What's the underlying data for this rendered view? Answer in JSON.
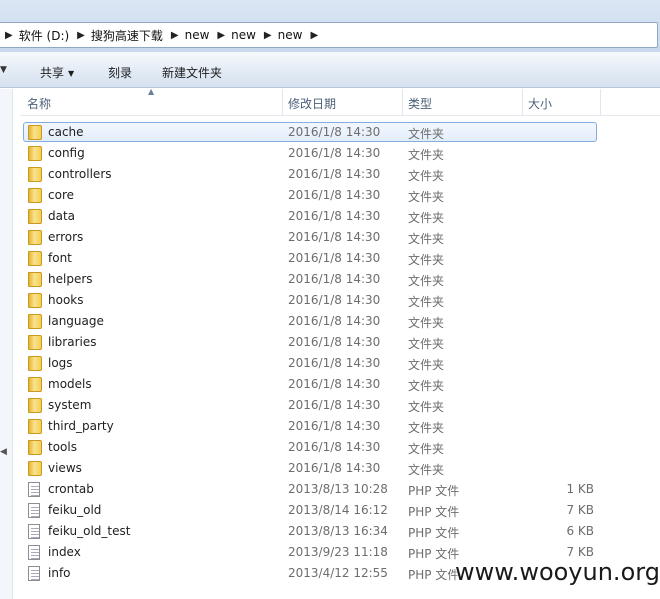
{
  "address_bar": {
    "crumbs": [
      "软件 (D:)",
      "搜狗高速下载",
      "new",
      "new",
      "new"
    ]
  },
  "toolbar": {
    "share_label": "共享",
    "burn_label": "刻录",
    "new_folder_label": "新建文件夹"
  },
  "columns": {
    "name": "名称",
    "modified": "修改日期",
    "type": "类型",
    "size": "大小"
  },
  "files": [
    {
      "name": "cache",
      "date": "2016/1/8 14:30",
      "type": "文件夹",
      "size": "",
      "icon": "folder-icon"
    },
    {
      "name": "config",
      "date": "2016/1/8 14:30",
      "type": "文件夹",
      "size": "",
      "icon": "folder-icon"
    },
    {
      "name": "controllers",
      "date": "2016/1/8 14:30",
      "type": "文件夹",
      "size": "",
      "icon": "folder-icon"
    },
    {
      "name": "core",
      "date": "2016/1/8 14:30",
      "type": "文件夹",
      "size": "",
      "icon": "folder-icon"
    },
    {
      "name": "data",
      "date": "2016/1/8 14:30",
      "type": "文件夹",
      "size": "",
      "icon": "folder-icon"
    },
    {
      "name": "errors",
      "date": "2016/1/8 14:30",
      "type": "文件夹",
      "size": "",
      "icon": "folder-icon"
    },
    {
      "name": "font",
      "date": "2016/1/8 14:30",
      "type": "文件夹",
      "size": "",
      "icon": "folder-icon"
    },
    {
      "name": "helpers",
      "date": "2016/1/8 14:30",
      "type": "文件夹",
      "size": "",
      "icon": "folder-icon"
    },
    {
      "name": "hooks",
      "date": "2016/1/8 14:30",
      "type": "文件夹",
      "size": "",
      "icon": "folder-icon"
    },
    {
      "name": "language",
      "date": "2016/1/8 14:30",
      "type": "文件夹",
      "size": "",
      "icon": "folder-icon"
    },
    {
      "name": "libraries",
      "date": "2016/1/8 14:30",
      "type": "文件夹",
      "size": "",
      "icon": "folder-icon"
    },
    {
      "name": "logs",
      "date": "2016/1/8 14:30",
      "type": "文件夹",
      "size": "",
      "icon": "folder-icon"
    },
    {
      "name": "models",
      "date": "2016/1/8 14:30",
      "type": "文件夹",
      "size": "",
      "icon": "folder-icon"
    },
    {
      "name": "system",
      "date": "2016/1/8 14:30",
      "type": "文件夹",
      "size": "",
      "icon": "folder-icon"
    },
    {
      "name": "third_party",
      "date": "2016/1/8 14:30",
      "type": "文件夹",
      "size": "",
      "icon": "folder-icon"
    },
    {
      "name": "tools",
      "date": "2016/1/8 14:30",
      "type": "文件夹",
      "size": "",
      "icon": "folder-icon"
    },
    {
      "name": "views",
      "date": "2016/1/8 14:30",
      "type": "文件夹",
      "size": "",
      "icon": "folder-icon"
    },
    {
      "name": "crontab",
      "date": "2013/8/13 10:28",
      "type": "PHP 文件",
      "size": "1 KB",
      "icon": "php-file-icon"
    },
    {
      "name": "feiku_old",
      "date": "2013/8/14 16:12",
      "type": "PHP 文件",
      "size": "7 KB",
      "icon": "php-file-icon"
    },
    {
      "name": "feiku_old_test",
      "date": "2013/8/13 16:34",
      "type": "PHP 文件",
      "size": "6 KB",
      "icon": "php-file-icon"
    },
    {
      "name": "index",
      "date": "2013/9/23 11:18",
      "type": "PHP 文件",
      "size": "7 KB",
      "icon": "php-file-icon"
    },
    {
      "name": "info",
      "date": "2013/4/12 12:55",
      "type": "PHP 文件",
      "size": "",
      "icon": "php-file-icon"
    }
  ],
  "selected_index": 0,
  "watermark": "www.wooyun.org"
}
